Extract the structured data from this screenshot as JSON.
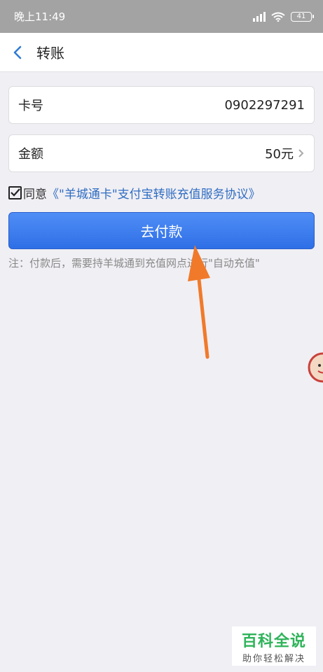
{
  "status_bar": {
    "time": "晚上11:49",
    "battery": "41"
  },
  "header": {
    "title": "转账"
  },
  "form": {
    "card_label": "卡号",
    "card_value": "0902297291",
    "amount_label": "金额",
    "amount_value": "50元"
  },
  "agreement": {
    "prefix": "同意",
    "link": "《\"羊城通卡\"支付宝转账充值服务协议》",
    "checked": true
  },
  "pay_button": {
    "label": "去付款"
  },
  "note": "注：付款后，需要持羊城通到充值网点进行\"自动充值\"",
  "watermark": {
    "main": "百科全说",
    "sub": "助你轻松解决"
  },
  "colors": {
    "accent": "#2f6fe6",
    "link": "#2f6dc2",
    "arrow": "#f07a2a",
    "watermark_green": "#2fb35a"
  }
}
